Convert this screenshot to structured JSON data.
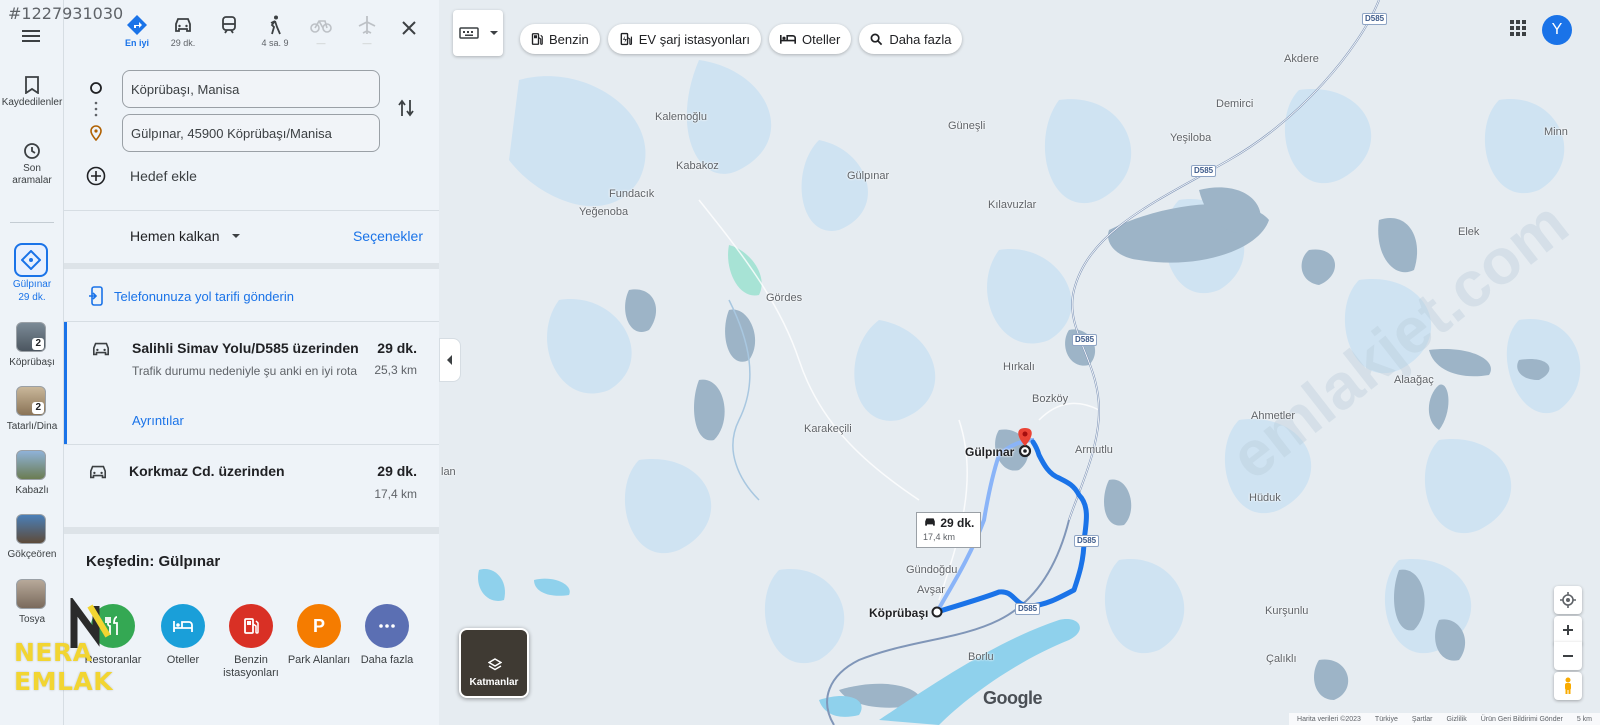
{
  "listing_id": "#1227931030",
  "rail": {
    "saved": "Kaydedilenler",
    "recent": "Son aramalar",
    "selected": {
      "label": "Gülpınar",
      "sub": "29 dk."
    },
    "items": [
      {
        "label": "Köprübaşı",
        "badge": "2"
      },
      {
        "label": "Tatarlı/Dina",
        "badge": "2"
      },
      {
        "label": "Kabazlı",
        "badge": ""
      },
      {
        "label": "Gökçeören",
        "badge": ""
      },
      {
        "label": "Tosya",
        "badge": ""
      }
    ]
  },
  "panel": {
    "modes": [
      {
        "label": "En iyi",
        "icon": "directions-icon"
      },
      {
        "label": "29 dk.",
        "icon": "car-icon"
      },
      {
        "label": "",
        "icon": "transit-icon"
      },
      {
        "label": "4 sa. 9",
        "icon": "walk-icon"
      },
      {
        "label": "—",
        "icon": "bike-icon"
      },
      {
        "label": "—",
        "icon": "flight-icon"
      }
    ],
    "origin": "Köprübaşı, Manisa",
    "destination": "Gülpınar, 45900 Köprübaşı/Manisa",
    "add_destination": "Hedef ekle",
    "depart": "Hemen kalkan",
    "options": "Seçenekler",
    "send_to_phone": "Telefonunuza yol tarifi gönderin",
    "routes": [
      {
        "title": "Salihli Simav Yolu/D585 üzerinden",
        "desc": "Trafik durumu nedeniyle şu anki en iyi rota",
        "time": "29 dk.",
        "distance": "25,3 km",
        "details": "Ayrıntılar"
      },
      {
        "title": "Korkmaz Cd. üzerinden",
        "desc": "",
        "time": "29 dk.",
        "distance": "17,4 km",
        "details": ""
      }
    ],
    "explore_title": "Keşfedin: Gülpınar",
    "explore": [
      {
        "label": "Restoranlar",
        "color": "#34a853"
      },
      {
        "label": "Oteller",
        "color": "#1a9fd9"
      },
      {
        "label": "Benzin istasyonları",
        "color": "#d93025"
      },
      {
        "label": "Park Alanları",
        "color": "#f57c00"
      },
      {
        "label": "Daha fazla",
        "color": "#5b6fb3"
      }
    ]
  },
  "map": {
    "chips": [
      {
        "label": "Benzin",
        "icon": "fuel-icon"
      },
      {
        "label": "EV şarj istasyonları",
        "icon": "ev-charger-icon"
      },
      {
        "label": "Oteller",
        "icon": "hotel-icon"
      },
      {
        "label": "Daha fazla",
        "icon": "search-icon"
      }
    ],
    "avatar": "Y",
    "places": {
      "akdere": "Akdere",
      "demirci": "Demirci",
      "kalemoglu": "Kalemoğlu",
      "gunesli": "Güneşli",
      "yesiloba": "Yeşiloba",
      "kabakoz": "Kabakoz",
      "fundacik": "Fundacık",
      "gulpinar_n": "Gülpınar",
      "yegenoba": "Yeğenoba",
      "kilavuzlar": "Kılavuzlar",
      "elek": "Elek",
      "gordes": "Gördes",
      "hirkali": "Hırkalı",
      "alaagac": "Alaağaç",
      "bozkoy": "Bozköy",
      "ahmetler": "Ahmetler",
      "karakecili": "Karakeçili",
      "armutlu": "Armutlu",
      "gulpinar": "Gülpınar",
      "lan": "lan",
      "huduk": "Hüduk",
      "gundogdu": "Gündoğdu",
      "aysar": "Avşar",
      "koprubasi": "Köprübaşı",
      "kursunlu": "Kurşunlu",
      "borlu": "Borlu",
      "caliki": "Çalıklı",
      "minn": "Minn"
    },
    "road": "D585",
    "callout_time": "29 dk.",
    "callout_dist": "17,4 km",
    "layers": "Katmanlar",
    "google": "Google",
    "attribution": [
      "Harita verileri ©2023",
      "Türkiye",
      "Şartlar",
      "Gizlilik",
      "Ürün Geri Bildirimi Gönder",
      "5 km"
    ]
  },
  "watermark": "emlakjet.com",
  "brand": "NERA EMLAK",
  "colors": {
    "accent": "#1a73e8",
    "route": "#1a73e8",
    "alt_route": "#8ab4f8",
    "pin": "#ea4335",
    "brand": "#f2d531"
  }
}
